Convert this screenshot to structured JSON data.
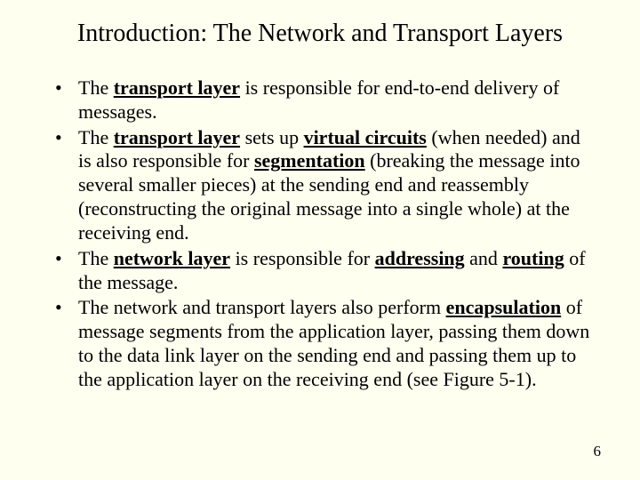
{
  "title": "Introduction: The Network and Transport Layers",
  "bullets": [
    {
      "t1": "The ",
      "s1": "transport layer",
      "t2": " is responsible for end-to-end delivery of messages."
    },
    {
      "t1": "The ",
      "s1": "transport layer",
      "t2": " sets up ",
      "s2": "virtual circuits",
      "t3": " (when needed) and is also responsible for ",
      "s3": "segmentation",
      "t4": " (breaking the message into several smaller pieces) at the sending end and reassembly (reconstructing the original message into a single whole) at the receiving end."
    },
    {
      "t1": "The ",
      "s1": "network layer",
      "t2": " is responsible for ",
      "s2": "addressing",
      "t3": " and ",
      "s3": "routing",
      "t4": " of the message."
    },
    {
      "t1": "The network and transport layers also perform ",
      "s1": "encapsulation",
      "t2": " of message segments from the application layer, passing them down to the data link layer on the sending end and passing them up to the application layer on the receiving end (see Figure 5-1)."
    }
  ],
  "page_number": "6"
}
